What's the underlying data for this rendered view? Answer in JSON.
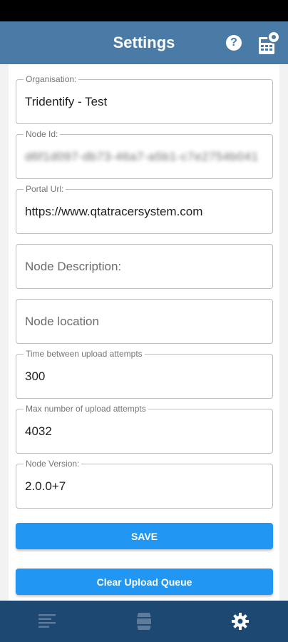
{
  "app_bar": {
    "title": "Settings",
    "help_icon": "help-circle-icon",
    "help_glyph": "?",
    "calculator_icon": "calculator-settings-icon"
  },
  "colors": {
    "app_bar": "#4a7aa6",
    "bottom_nav": "#1d4872",
    "button": "#2196f3",
    "field_border": "#bdbdbd"
  },
  "fields": [
    {
      "label": "Organisation:",
      "value": "Tridentify - Test"
    },
    {
      "label": "Node Id:",
      "value": "d6f1d097-db73-46a7-a5b1-c7e2754b041",
      "redacted": true
    },
    {
      "label": "Portal Url:",
      "value": "https://www.qtatracersystem.com"
    },
    {
      "label": "",
      "value": "",
      "placeholder": "Node Description:"
    },
    {
      "label": "",
      "value": "",
      "placeholder": "Node location"
    },
    {
      "label": "Time between upload attempts",
      "value": "300"
    },
    {
      "label": "Max number of upload attempts",
      "value": "4032"
    },
    {
      "label": "Node Version:",
      "value": "2.0.0+7"
    }
  ],
  "buttons": {
    "save_label": "SAVE",
    "clear_queue_label": "Clear Upload Queue"
  },
  "bottom_nav": {
    "items": [
      {
        "icon": "list-lines-icon",
        "active": false
      },
      {
        "icon": "barrel-icon",
        "active": false
      },
      {
        "icon": "gear-icon",
        "active": true
      }
    ]
  }
}
